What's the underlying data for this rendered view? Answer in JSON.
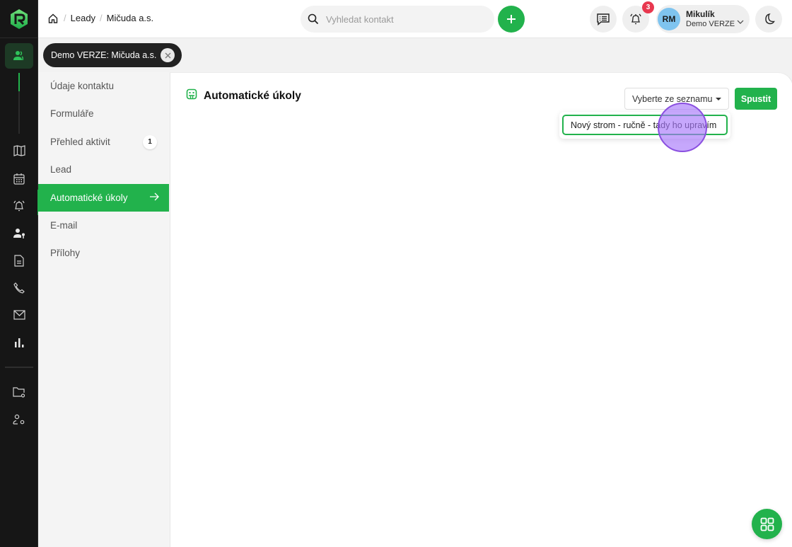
{
  "breadcrumb": {
    "home_icon": "home-icon",
    "items": [
      "Leady",
      "Mičuda a.s."
    ]
  },
  "search": {
    "placeholder": "Vyhledat kontakt",
    "value": ""
  },
  "header": {
    "add_icon": "plus-icon",
    "messages_icon": "message-list-icon",
    "notifications_icon": "bell-icon",
    "notifications_count": "3",
    "user": {
      "initials": "RM",
      "name": "Mikulík",
      "org": "Demo VERZE"
    },
    "theme_icon": "moon-icon"
  },
  "rail": {
    "items": [
      "contacts-icon",
      "map-icon",
      "calendar-icon",
      "bell-icon",
      "user-key-icon",
      "document-icon",
      "phone-icon",
      "mail-icon",
      "bar-chart-icon",
      "folder-settings-icon",
      "user-settings-icon"
    ]
  },
  "tab_chip": {
    "label": "Demo VERZE: Mičuda a.s."
  },
  "submenu": {
    "items": [
      {
        "label": "Údaje kontaktu"
      },
      {
        "label": "Formuláře"
      },
      {
        "label": "Přehled aktivit",
        "count": "1"
      },
      {
        "label": "Lead"
      },
      {
        "label": "Automatické úkoly",
        "active": true
      },
      {
        "label": "E-mail"
      },
      {
        "label": "Přílohy"
      }
    ]
  },
  "panel": {
    "title": "Automatické úkoly",
    "select_placeholder": "Vyberte ze seznamu",
    "run_label": "Spustit",
    "dropdown_options": [
      "Nový strom - ručně - tady ho upravím"
    ]
  },
  "colors": {
    "accent": "#22b24c",
    "rail_bg": "#161616",
    "badge": "#e8384f"
  }
}
